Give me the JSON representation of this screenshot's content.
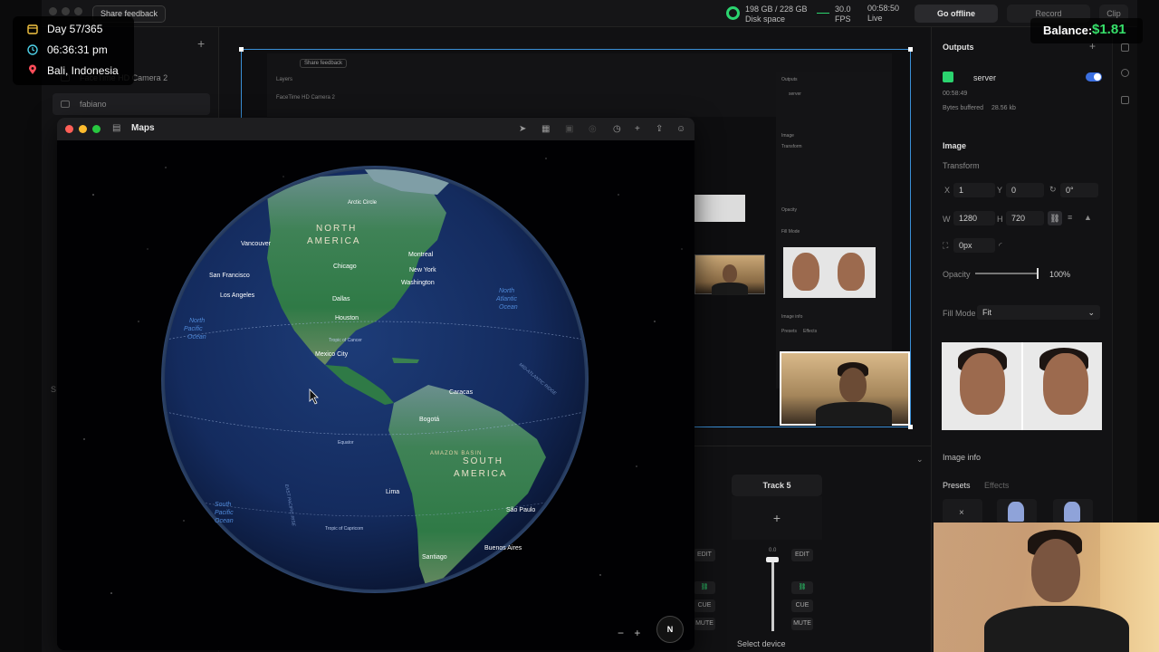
{
  "topbar": {
    "share_feedback": "Share feedback",
    "disk_line1": "198 GB / 228 GB",
    "disk_line2": "Disk space",
    "fps_value": "30.0",
    "fps_label": "FPS",
    "live_time": "00:58:50",
    "live_label": "Live",
    "go_offline": "Go offline",
    "record": "Record",
    "clip": "Clip"
  },
  "layers": {
    "items": [
      "FaceTime HD Camera 2",
      "fabiano"
    ],
    "side_letter": "S"
  },
  "preview": {
    "nested_share": "Share feedback",
    "nested_layers": "Layers",
    "nested_item": "FaceTime HD Camera 2",
    "nested_outputs": "Outputs",
    "nested_server": "server",
    "nested_image": "Image",
    "nested_transform": "Transform",
    "nested_opacity": "Opacity",
    "nested_fill": "Fill Mode",
    "nested_info": "Image info",
    "nested_presets": "Presets",
    "nested_effects": "Effects"
  },
  "tracks": {
    "track5": "Track 5",
    "add": "+",
    "edit": "EDIT",
    "cue": "CUE",
    "mute": "MUTE",
    "level": "0.0",
    "select_device": "Select device"
  },
  "props": {
    "outputs_title": "Outputs",
    "server_name": "server",
    "server_time": "00:58:49",
    "bytes_label": "Bytes buffered",
    "bytes_value": "28.56 kb",
    "image_title": "Image",
    "transform_label": "Transform",
    "x_label": "X",
    "x_value": "1",
    "y_label": "Y",
    "y_value": "0",
    "rot_value": "0°",
    "w_label": "W",
    "w_value": "1280",
    "h_label": "H",
    "h_value": "720",
    "radius_value": "0px",
    "opacity_label": "Opacity",
    "opacity_value": "100%",
    "opacity_level": 1.0,
    "fill_mode_label": "Fill Mode",
    "fill_mode_value": "Fit",
    "image_info": "Image info",
    "presets": "Presets",
    "effects": "Effects"
  },
  "maps": {
    "title": "Maps",
    "labels": {
      "north_america": [
        "NORTH",
        "AMERICA"
      ],
      "south_america": [
        "SOUTH",
        "AMERICA"
      ],
      "arctic": "Arctic Circle",
      "tropic_cancer": "Tropic of Cancer",
      "tropic_capricorn": "Tropic of Capricorn",
      "equator": "Equator",
      "amazon": "AMAZON BASIN",
      "north_pacific": [
        "North",
        "Pacific",
        "Ocean"
      ],
      "north_atlantic": [
        "North",
        "Atlantic",
        "Ocean"
      ],
      "south_pacific": [
        "South",
        "Pacific",
        "Ocean"
      ],
      "ridge": "MID-ATLANTIC RIDGE",
      "rise": "EAST PACIFIC RISE",
      "cities": {
        "vancouver": "Vancouver",
        "montreal": "Montreal",
        "chicago": "Chicago",
        "new_york": "New York",
        "washington": "Washington",
        "san_francisco": "San Francisco",
        "los_angeles": "Los Angeles",
        "dallas": "Dallas",
        "houston": "Houston",
        "mexico_city": "Mexico City",
        "caracas": "Caracas",
        "bogota": "Bogotá",
        "lima": "Lima",
        "sao_paulo": "São Paulo",
        "buenos_aires": "Buenos Aires",
        "santiago": "Santiago"
      }
    },
    "compass": "N",
    "zoom_minus": "−",
    "zoom_plus": "+"
  },
  "overlay": {
    "day": "Day 57/365",
    "time": "06:36:31 pm",
    "location": "Bali, Indonesia",
    "balance_label": "Balance:",
    "balance_value": "$1.81"
  },
  "colors": {
    "accent_green": "#2bd46f",
    "selection_blue": "#3a8fd6",
    "balance_green": "#36e06a",
    "toggle_blue": "#3b6fe0"
  },
  "icons": [
    "calendar-icon",
    "clock-icon",
    "location-pin-icon",
    "sidebar-toggle-icon",
    "navigate-icon",
    "map-mode-icon",
    "look-around-icon",
    "add-icon",
    "share-icon",
    "account-icon",
    "link-icon",
    "compass-icon"
  ]
}
